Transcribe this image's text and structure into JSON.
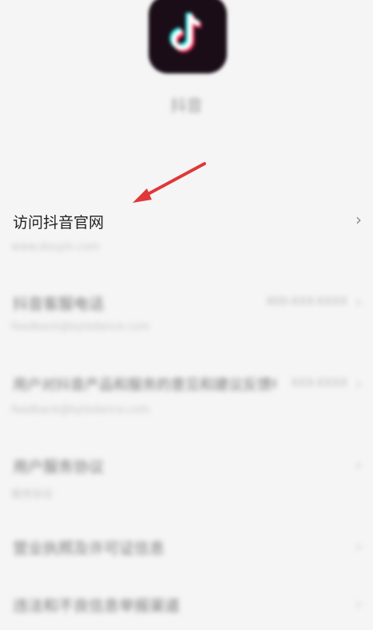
{
  "app": {
    "name": "抖音",
    "icon": "tiktok-logo-icon"
  },
  "rows": [
    {
      "title": "访问抖音官网",
      "subtitle": "www.douyin.com",
      "value": "",
      "chevron": "›"
    },
    {
      "title": "抖音客服电话",
      "subtitle": "feedback@bytedance.com",
      "value": "400-XXX-XXXX",
      "chevron": "›"
    },
    {
      "title": "用户对抖音产品和服务的意见和建议反馈电话",
      "subtitle": "feedback@bytedance.com",
      "value": "XXX-XXXX",
      "chevron": "›"
    },
    {
      "title": "用户服务协议",
      "subtitle": "服务协议",
      "value": "",
      "chevron": "›"
    },
    {
      "title": "营业执照及许可证信息",
      "subtitle": "",
      "value": "",
      "chevron": "›"
    },
    {
      "title": "违法和不良信息举报渠道",
      "subtitle": "",
      "value": "",
      "chevron": "›"
    }
  ],
  "colors": {
    "arrow": "#e0373a",
    "background": "#f5f5f5",
    "icon_bg": "#1a0d17",
    "icon_cyan": "#25f4ee",
    "icon_red": "#fe2c55"
  }
}
